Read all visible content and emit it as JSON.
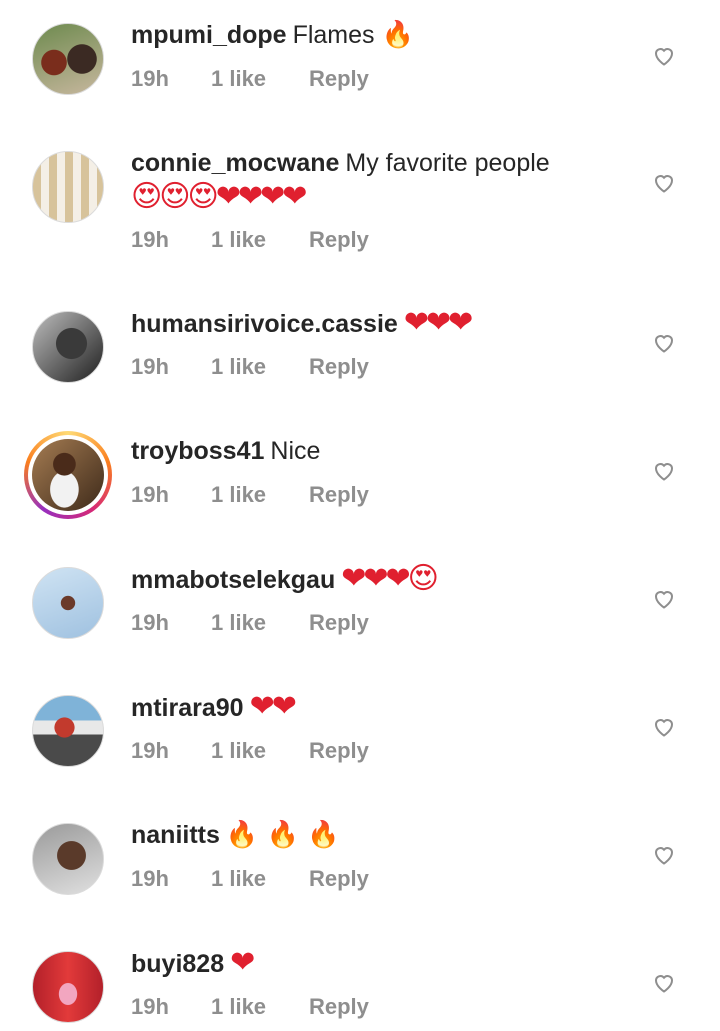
{
  "comments": [
    {
      "username": "mpumi_dope",
      "text": "Flames",
      "emoji": "🔥",
      "time": "19h",
      "likes": "1 like",
      "reply": "Reply"
    },
    {
      "username": "connie_mocwane",
      "text": "My favorite people",
      "emoji": "😍😍😍❤❤❤❤",
      "time": "19h",
      "likes": "1 like",
      "reply": "Reply"
    },
    {
      "username": "humansirivoice.cassie",
      "text": "",
      "emoji": "❤❤❤",
      "time": "19h",
      "likes": "1 like",
      "reply": "Reply"
    },
    {
      "username": "troyboss41",
      "text": "Nice",
      "emoji": "",
      "time": "19h",
      "likes": "1 like",
      "reply": "Reply"
    },
    {
      "username": "mmabotselekgau",
      "text": "",
      "emoji": "❤❤❤😍",
      "time": "19h",
      "likes": "1 like",
      "reply": "Reply"
    },
    {
      "username": "mtirara90",
      "text": "",
      "emoji": "❤❤",
      "time": "19h",
      "likes": "1 like",
      "reply": "Reply"
    },
    {
      "username": "naniitts",
      "text": "",
      "emoji": "🔥 🔥 🔥",
      "time": "19h",
      "likes": "1 like",
      "reply": "Reply"
    },
    {
      "username": "buyi828",
      "text": "",
      "emoji": "❤",
      "time": "19h",
      "likes": "1 like",
      "reply": "Reply"
    }
  ],
  "colors": {
    "meta": "#8e8e8e",
    "text": "#262626",
    "heart_outline": "#8e8e8e"
  },
  "icons": {
    "like": "heart-outline-icon"
  }
}
